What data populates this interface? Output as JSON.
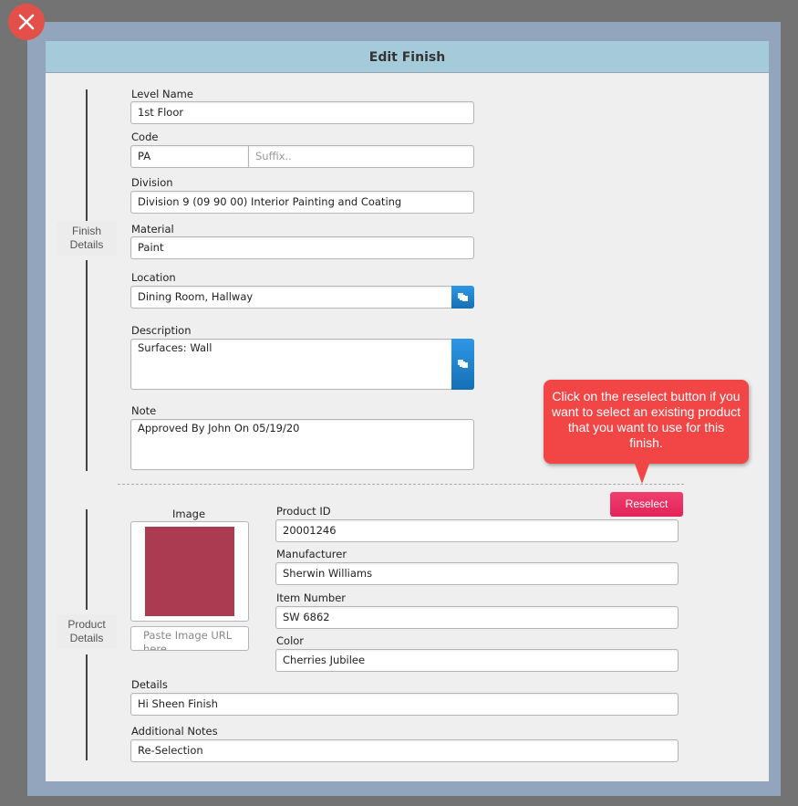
{
  "dialog": {
    "title": "Edit Finish",
    "close_icon": "close-x-icon"
  },
  "finish_details": {
    "section_label_line1": "Finish",
    "section_label_line2": "Details",
    "level_name": {
      "label": "Level Name",
      "value": "1st Floor"
    },
    "code": {
      "label": "Code",
      "value": "PA",
      "suffix_placeholder": "Suffix.."
    },
    "division": {
      "label": "Division",
      "value": "Division 9 (09 90 00) Interior Painting and Coating"
    },
    "material": {
      "label": "Material",
      "value": "Paint"
    },
    "location": {
      "label": "Location",
      "value": "Dining Room, Hallway",
      "picker_icon": "multi-select-icon"
    },
    "description": {
      "label": "Description",
      "value": "Surfaces: Wall",
      "picker_icon": "multi-select-icon"
    },
    "note": {
      "label": "Note",
      "value": "Approved By John On 05/19/20"
    }
  },
  "tooltip": {
    "text": "Click on the reselect button if you want to select an existing product that you want to use for this finish.",
    "color": "#f24646"
  },
  "reselect_button": {
    "label": "Reselect",
    "color": "#e8295f"
  },
  "product_details": {
    "section_label_line1": "Product",
    "section_label_line2": "Details",
    "image": {
      "label": "Image",
      "swatch_color": "#ab3b51",
      "url_placeholder": "Paste Image URL here"
    },
    "product_id": {
      "label": "Product ID",
      "value": "20001246"
    },
    "manufacturer": {
      "label": "Manufacturer",
      "value": "Sherwin Williams"
    },
    "item_number": {
      "label": "Item Number",
      "value": "SW 6862"
    },
    "color": {
      "label": "Color",
      "value": "Cherries Jubilee"
    },
    "details": {
      "label": "Details",
      "value": "Hi Sheen Finish"
    },
    "additional_notes": {
      "label": "Additional Notes",
      "value": "Re-Selection"
    }
  }
}
